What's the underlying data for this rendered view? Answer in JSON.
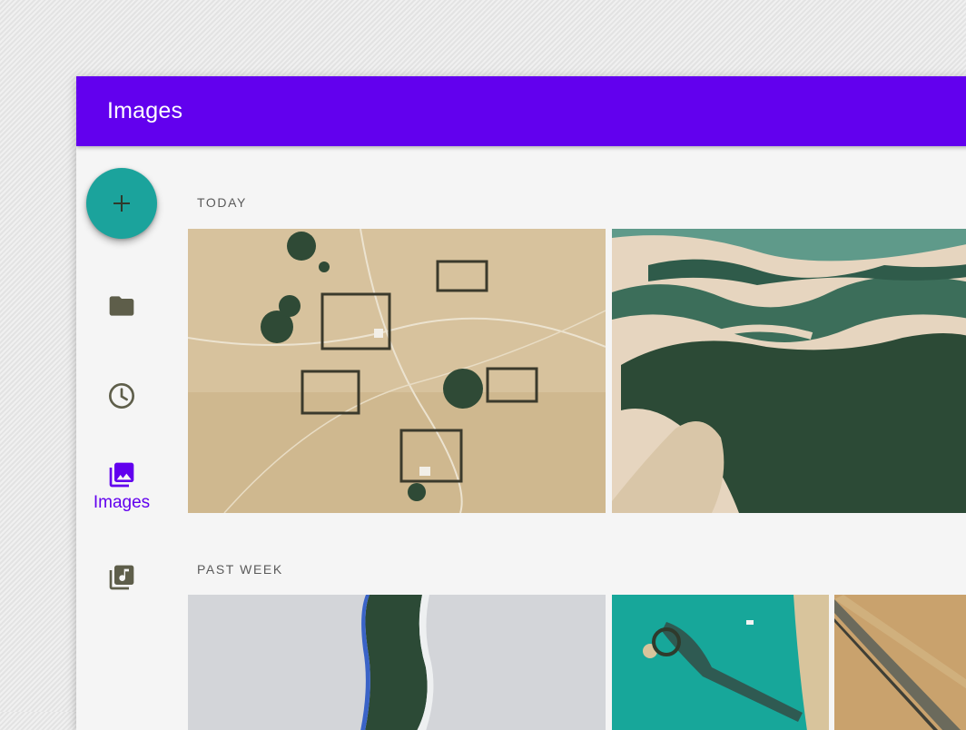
{
  "app": {
    "title": "Images"
  },
  "rail": {
    "fab_icon": "add-icon",
    "items": [
      {
        "icon": "folder-icon",
        "label": ""
      },
      {
        "icon": "clock-icon",
        "label": ""
      },
      {
        "icon": "image-library-icon",
        "label": "Images"
      },
      {
        "icon": "music-library-icon",
        "label": ""
      }
    ]
  },
  "sections": [
    {
      "label": "TODAY"
    },
    {
      "label": "PAST WEEK"
    }
  ],
  "colors": {
    "primary": "#6200ee",
    "fab": "#1ba39c",
    "rail_icon": "#5e5e4a"
  }
}
